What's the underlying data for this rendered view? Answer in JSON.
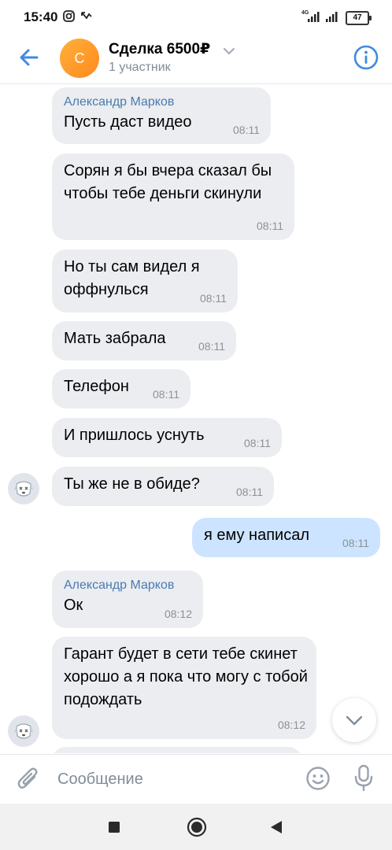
{
  "status_bar": {
    "time": "15:40",
    "network": "4G",
    "battery": "47",
    "icons": [
      "instagram-icon",
      "missed-call-icon",
      "signal-icon",
      "signal-icon",
      "battery-icon"
    ]
  },
  "header": {
    "back_icon": "arrow-left-icon",
    "avatar_letter": "С",
    "title": "Сделка 6500₽",
    "subtitle": "1 участник",
    "info_icon": "info-icon"
  },
  "messages": [
    {
      "sender": "Александр Марков",
      "text": "Пусть даст видео",
      "time": "08:11",
      "direction": "in"
    },
    {
      "text": "Сорян я бы вчера сказал бы чтобы тебе деньги скинули",
      "time": "08:11",
      "direction": "in"
    },
    {
      "text": "Но ты сам видел я оффнулься",
      "time": "08:11",
      "direction": "in"
    },
    {
      "text": "Мать забрала",
      "time": "08:11",
      "direction": "in"
    },
    {
      "text": "Телефон",
      "time": "08:11",
      "direction": "in"
    },
    {
      "text": "И пришлось уснуть",
      "time": "08:11",
      "direction": "in"
    },
    {
      "text": "Ты же не в обиде?",
      "time": "08:11",
      "direction": "in"
    },
    {
      "text": "я ему написал",
      "time": "08:11",
      "direction": "out"
    },
    {
      "sender": "Александр Марков",
      "text": "Ок",
      "time": "08:12",
      "direction": "in"
    },
    {
      "text": "Гарант будет в сети тебе скинет хорошо а я пока что могу с тобой подождать",
      "time": "08:12",
      "direction": "in"
    }
  ],
  "composer": {
    "placeholder": "Сообщение",
    "value": "",
    "icons": [
      "paperclip-icon",
      "smile-icon",
      "microphone-icon"
    ]
  },
  "colors": {
    "accent": "#3f8ae0",
    "incoming_bubble": "#ebedf0",
    "outgoing_bubble": "#cce4ff",
    "sender_name": "#4a7bb0",
    "avatar": "#ff9a2e"
  }
}
